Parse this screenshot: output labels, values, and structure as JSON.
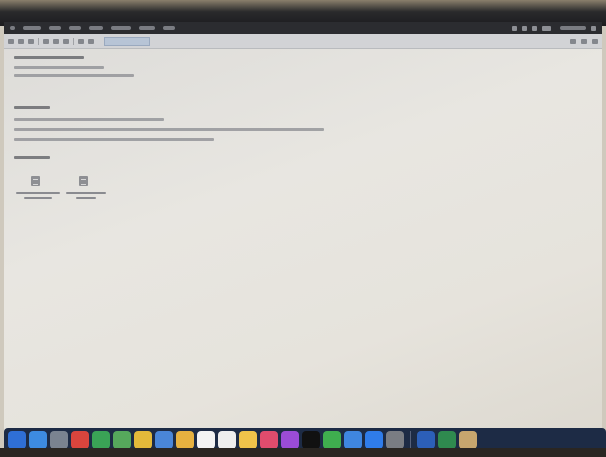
{
  "menubar": {
    "items": [
      "",
      "",
      "",
      "",
      "",
      "",
      ""
    ],
    "status_items": [
      "",
      "",
      "",
      "",
      "",
      ""
    ]
  },
  "toolbar": {
    "buttons": [
      "",
      "",
      "",
      "",
      "",
      "",
      "",
      "",
      "",
      ""
    ],
    "search_placeholder": "",
    "right_buttons": [
      "",
      "",
      ""
    ]
  },
  "message": {
    "header_lines": [
      "",
      "",
      ""
    ],
    "body_lines": [
      "",
      "",
      "",
      "",
      ""
    ],
    "attachments": [
      {
        "name": "",
        "sub": ""
      },
      {
        "name": "",
        "sub": ""
      }
    ]
  },
  "dock": {
    "icons": [
      {
        "name": "finder-icon",
        "color": "#2f6fd6"
      },
      {
        "name": "safari-icon",
        "color": "#3d8be0"
      },
      {
        "name": "launchpad-icon",
        "color": "#7a8390"
      },
      {
        "name": "no-sign-icon",
        "color": "#d9453d"
      },
      {
        "name": "maps-icon",
        "color": "#3aa356"
      },
      {
        "name": "photos-icon",
        "color": "#56a85c"
      },
      {
        "name": "chrome-icon",
        "color": "#e3b93a"
      },
      {
        "name": "mail-icon",
        "color": "#4a86d8"
      },
      {
        "name": "notes-icon",
        "color": "#e6b140"
      },
      {
        "name": "calendar-icon",
        "color": "#f3f3f3"
      },
      {
        "name": "reminders-icon",
        "color": "#eeeeee"
      },
      {
        "name": "pages-icon",
        "color": "#f0c34a"
      },
      {
        "name": "music-icon",
        "color": "#e04c6d"
      },
      {
        "name": "podcasts-icon",
        "color": "#9b4cd6"
      },
      {
        "name": "tv-icon",
        "color": "#111111"
      },
      {
        "name": "numbers-icon",
        "color": "#3fae4f"
      },
      {
        "name": "keynote-icon",
        "color": "#3f86e0"
      },
      {
        "name": "appstore-icon",
        "color": "#2f7cea"
      },
      {
        "name": "preferences-icon",
        "color": "#7a7d83"
      },
      {
        "name": "word-icon",
        "color": "#2c5fb8"
      },
      {
        "name": "excel-icon",
        "color": "#2f8a4f"
      },
      {
        "name": "trash-icon",
        "color": "#c7a66e"
      }
    ]
  }
}
